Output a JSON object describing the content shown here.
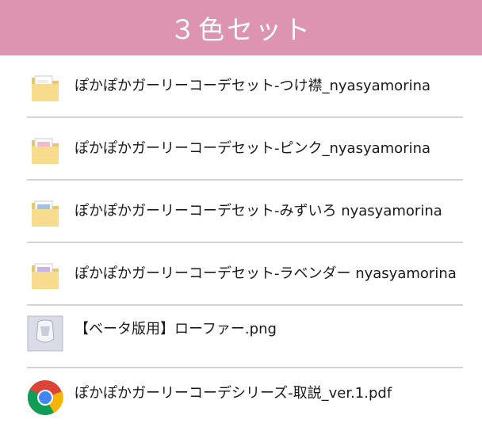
{
  "header": {
    "title": "３色セット",
    "background_color": "#dc94b0"
  },
  "files": [
    {
      "name": "ぽかぽかガーリーコーデセット-つけ襟_nyasyamorina",
      "icon": "folder-icon",
      "accent": "#ffffff"
    },
    {
      "name": "ぽかぽかガーリーコーデセット-ピンク_nyasyamorina",
      "icon": "folder-icon",
      "accent": "#f4b9cc"
    },
    {
      "name": "ぽかぽかガーリーコーデセット-みずいろ nyasyamorina",
      "icon": "folder-icon",
      "accent": "#9fc3e6"
    },
    {
      "name": "ぽかぽかガーリーコーデセット-ラベンダー nyasyamorina",
      "icon": "folder-icon",
      "accent": "#c7b3e6"
    },
    {
      "name": "【ベータ版用】ローファー.png",
      "icon": "image-thumbnail-icon",
      "accent": "#d9dbe6"
    },
    {
      "name": "ぽかぽかガーリーコーデシリーズ-取説_ver.1.pdf",
      "icon": "chrome-icon",
      "accent": "#4285f4"
    }
  ]
}
